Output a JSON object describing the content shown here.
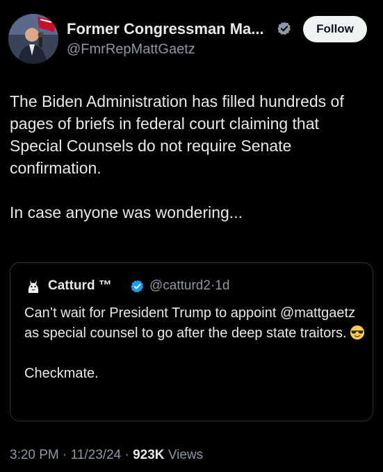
{
  "tweet": {
    "author_name": "Former Congressman Ma...",
    "author_handle": "@FmrRepMattGaetz",
    "follow_label": "Follow",
    "text_para1": "The Biden Administration has filled hundreds of pages of briefs in federal court claiming that Special Counsels do not require Senate confirmation.",
    "text_para2": "In case anyone was wondering...",
    "time": "3:20 PM",
    "date": "11/23/24",
    "views_count": "923K",
    "views_label": "Views",
    "separator": "·"
  },
  "quoted": {
    "author_name": "Catturd ™",
    "author_handle": "@catturd2",
    "separator": "·",
    "age": "1d",
    "text_line1": "Can’t wait for President Trump to appoint @mattgaetz as special counsel to go after the deep state traitors.",
    "emoji": "smiling-face-with-sunglasses",
    "text_para2": "Checkmate."
  },
  "colors": {
    "background": "#000000",
    "text": "#e7e9ea",
    "secondary": "#8b98a5",
    "verified": "#1d9bf0",
    "border": "#2f3336",
    "follow_bg": "#eff3f4"
  }
}
